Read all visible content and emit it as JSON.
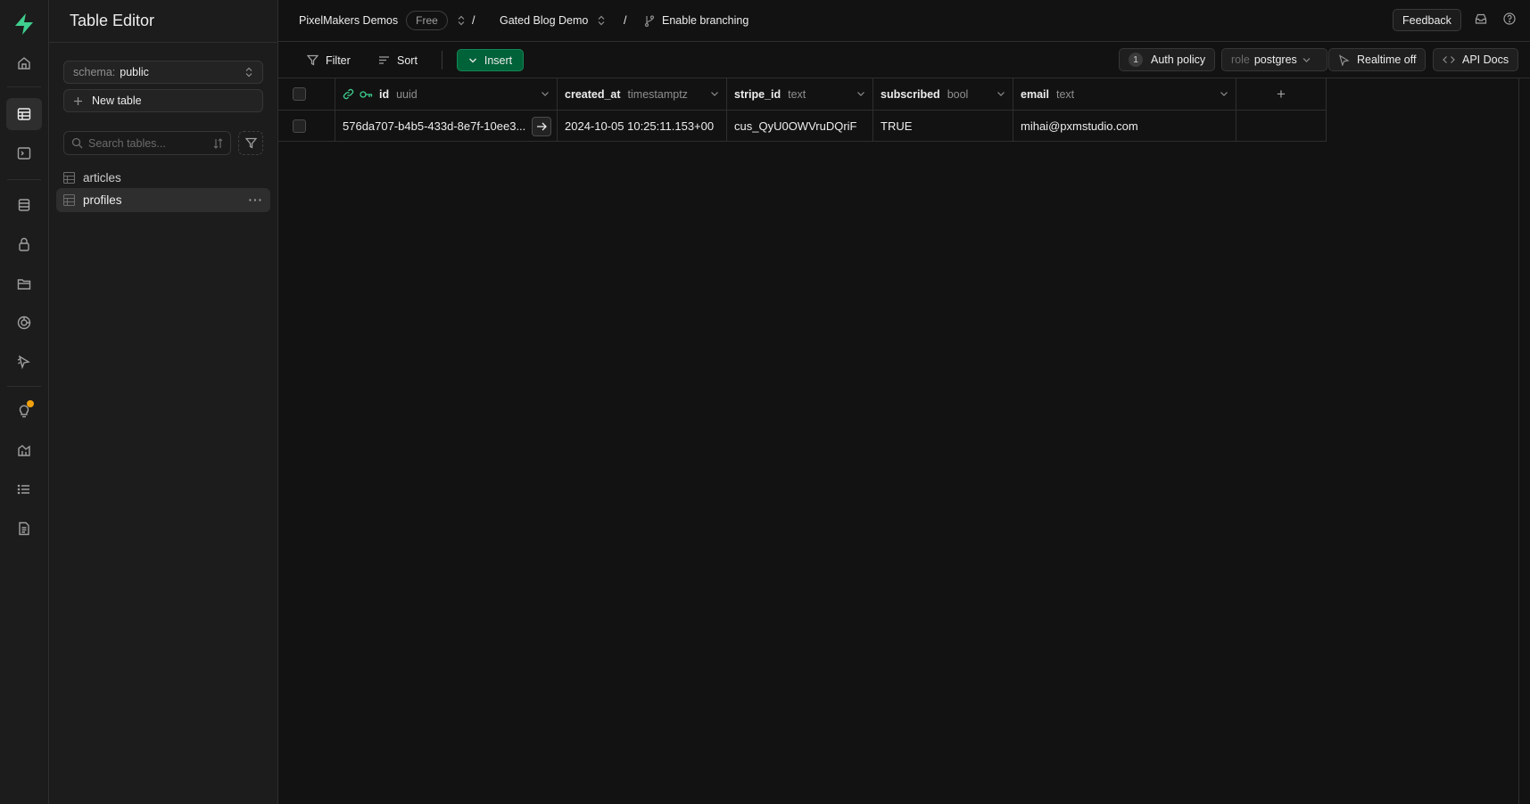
{
  "sidebar_panel": {
    "title": "Table Editor",
    "schema_label": "schema:",
    "schema_value": "public",
    "new_table_label": "New table",
    "search_placeholder": "Search tables...",
    "tables": [
      {
        "name": "articles",
        "active": false
      },
      {
        "name": "profiles",
        "active": true
      }
    ]
  },
  "header": {
    "org_name": "PixelMakers Demos",
    "plan_badge": "Free",
    "project_name": "Gated Blog Demo",
    "branching_label": "Enable branching",
    "feedback_label": "Feedback"
  },
  "toolbar": {
    "filter_label": "Filter",
    "sort_label": "Sort",
    "insert_label": "Insert",
    "auth_policy_count": "1",
    "auth_policy_label": "Auth policy",
    "role_prefix": "role",
    "role_value": "postgres",
    "realtime_label": "Realtime off",
    "api_docs_label": "API Docs"
  },
  "table": {
    "columns": [
      {
        "name": "id",
        "type": "uuid"
      },
      {
        "name": "created_at",
        "type": "timestamptz"
      },
      {
        "name": "stripe_id",
        "type": "text"
      },
      {
        "name": "subscribed",
        "type": "bool"
      },
      {
        "name": "email",
        "type": "text"
      }
    ],
    "add_column_label": "+",
    "rows": [
      [
        "576da707-b4b5-433d-8e7f-10ee3...",
        "2024-10-05 10:25:11.153+00",
        "cus_QyU0OWVruDQriF",
        "TRUE",
        "mihai@pxmstudio.com"
      ]
    ]
  },
  "colors": {
    "accent": "#3ecf8e",
    "insert_bg": "#006239",
    "notification_dot": "#f1a10d"
  }
}
